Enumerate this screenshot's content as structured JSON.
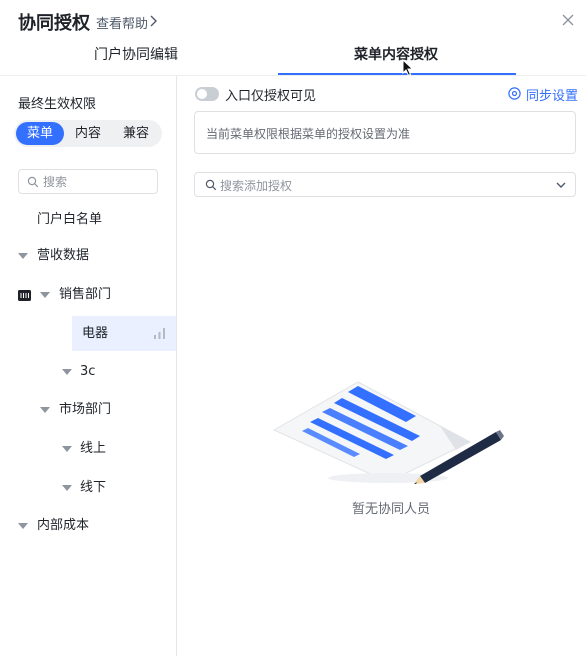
{
  "header": {
    "title": "协同授权",
    "help_link": "查看帮助"
  },
  "tabs": [
    {
      "label": "门户协同编辑",
      "active": false
    },
    {
      "label": "菜单内容授权",
      "active": true
    }
  ],
  "left": {
    "section_label": "最终生效权限",
    "segments": [
      {
        "label": "菜单",
        "active": true
      },
      {
        "label": "内容",
        "active": false
      },
      {
        "label": "兼容",
        "active": false
      }
    ],
    "search_placeholder": "搜索",
    "tree": [
      {
        "label": "门户白名单",
        "icon": "whitelist-icon"
      },
      {
        "label": "营收数据"
      },
      {
        "label": "销售部门"
      },
      {
        "label": "电器",
        "selected": true,
        "icon": "bar-chart-icon"
      },
      {
        "label": "3c"
      },
      {
        "label": "市场部门"
      },
      {
        "label": "线上"
      },
      {
        "label": "线下"
      },
      {
        "label": "内部成本"
      }
    ]
  },
  "right": {
    "toggle_label": "入口仅授权可见",
    "toggle_on": false,
    "sync_label": "同步设置",
    "info_text": "当前菜单权限根据菜单的授权设置为准",
    "auth_search_placeholder": "搜索添加授权",
    "empty_text": "暂无协同人员"
  },
  "colors": {
    "accent": "#3370ff",
    "selected_row_bg": "#eaf0ff",
    "toggle_off": "#c9cdd4",
    "border": "#dee0e3"
  }
}
